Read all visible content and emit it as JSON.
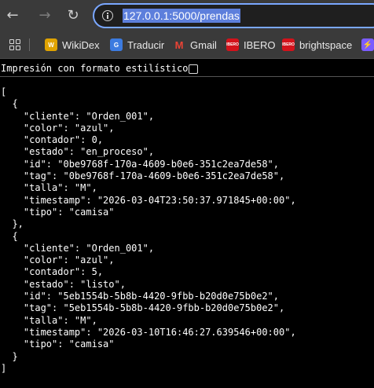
{
  "address_bar": {
    "url": "127.0.0.1:5000/prendas"
  },
  "bookmarks": [
    {
      "label": "WikiDex",
      "icon": "wikidex-icon",
      "color": "#e0a300"
    },
    {
      "label": "Traducir",
      "icon": "translate-icon",
      "color": "#3c7be0"
    },
    {
      "label": "Gmail",
      "icon": "gmail-icon",
      "color": "#ea4335"
    },
    {
      "label": "IBERO",
      "icon": "ibero-icon",
      "color": "#d3121b"
    },
    {
      "label": "brightspace",
      "icon": "ibero-icon",
      "color": "#d3121b"
    }
  ],
  "viewer": {
    "pretty_print_label": "Impresión con formato estilístico",
    "pretty_print_checked": false,
    "json_text": "[\n  {\n    \"cliente\": \"Orden_001\",\n    \"color\": \"azul\",\n    \"contador\": 0,\n    \"estado\": \"en_proceso\",\n    \"id\": \"0be9768f-170a-4609-b0e6-351c2ea7de58\",\n    \"tag\": \"0be9768f-170a-4609-b0e6-351c2ea7de58\",\n    \"talla\": \"M\",\n    \"timestamp\": \"2026-03-04T23:50:37.971845+00:00\",\n    \"tipo\": \"camisa\"\n  },\n  {\n    \"cliente\": \"Orden_001\",\n    \"color\": \"azul\",\n    \"contador\": 5,\n    \"estado\": \"listo\",\n    \"id\": \"5eb1554b-5b8b-4420-9fbb-b20d0e75b0e2\",\n    \"tag\": \"5eb1554b-5b8b-4420-9fbb-b20d0e75b0e2\",\n    \"talla\": \"M\",\n    \"timestamp\": \"2026-03-10T16:46:27.639546+00:00\",\n    \"tipo\": \"camisa\"\n  }\n]"
  }
}
